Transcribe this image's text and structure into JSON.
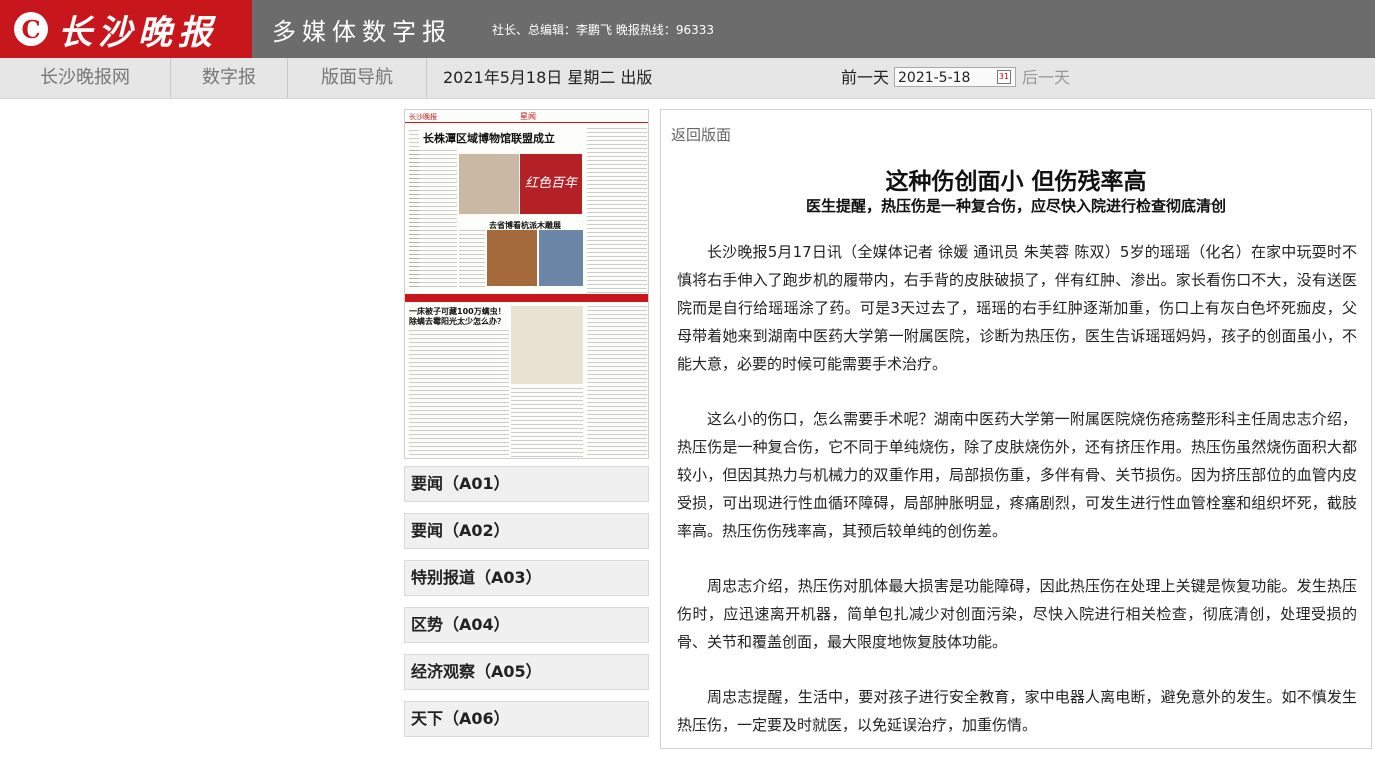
{
  "header": {
    "logo_mark": "C",
    "logo_text": "长沙晚报",
    "site_title": "多媒体数字报",
    "editor_line": "社长、总编辑：李鹏飞 晚报热线：96333",
    "brand_color": "#c8161d",
    "bar_color": "#6c6c6c"
  },
  "nav": {
    "items": [
      "长沙晚报网",
      "数字报",
      "版面导航"
    ],
    "date_text": "2021年5月18日 星期二 出版",
    "prev_label": "前一天",
    "date_value": "2021-5-18",
    "calendar_icon_text": "31",
    "next_label": "后一天"
  },
  "thumbnail": {
    "logo": "长沙晚报",
    "section": "星闻",
    "headline1": "长株潭区域博物馆联盟成立",
    "headline2": "去省博看杭派木雕展",
    "headline3": "一床被子可藏100万螨虫！",
    "headline4": "除螨去霉阳光太少怎么办？"
  },
  "sections": [
    "要闻（A01）",
    "要闻（A02）",
    "特别报道（A03）",
    "区势（A04）",
    "经济观察（A05）",
    "天下（A06）"
  ],
  "article": {
    "back_label": "返回版面",
    "title": "这种伤创面小 但伤残率高",
    "subtitle": "医生提醒，热压伤是一种复合伤，应尽快入院进行检查彻底清创",
    "paragraphs": [
      "长沙晚报5月17日讯（全媒体记者 徐媛 通讯员 朱芙蓉 陈双）5岁的瑶瑶（化名）在家中玩耍时不慎将右手伸入了跑步机的履带内，右手背的皮肤破损了，伴有红肿、渗出。家长看伤口不大，没有送医院而是自行给瑶瑶涂了药。可是3天过去了，瑶瑶的右手红肿逐渐加重，伤口上有灰白色坏死痂皮，父母带着她来到湖南中医药大学第一附属医院，诊断为热压伤，医生告诉瑶瑶妈妈，孩子的创面虽小，不能大意，必要的时候可能需要手术治疗。",
      "这么小的伤口，怎么需要手术呢？湖南中医药大学第一附属医院烧伤疮疡整形科主任周忠志介绍，热压伤是一种复合伤，它不同于单纯烧伤，除了皮肤烧伤外，还有挤压作用。热压伤虽然烧伤面积大都较小，但因其热力与机械力的双重作用，局部损伤重，多伴有骨、关节损伤。因为挤压部位的血管内皮受损，可出现进行性血循环障碍，局部肿胀明显，疼痛剧烈，可发生进行性血管栓塞和组织坏死，截肢率高。热压伤伤残率高，其预后较单纯的创伤差。",
      "周忠志介绍，热压伤对肌体最大损害是功能障碍，因此热压伤在处理上关键是恢复功能。发生热压伤时，应迅速离开机器，简单包扎减少对创面污染，尽快入院进行相关检查，彻底清创，处理受损的骨、关节和覆盖创面，最大限度地恢复肢体功能。",
      "周忠志提醒，生活中，要对孩子进行安全教育，家中电器人离电断，避免意外的发生。如不慎发生热压伤，一定要及时就医，以免延误治疗，加重伤情。"
    ]
  }
}
